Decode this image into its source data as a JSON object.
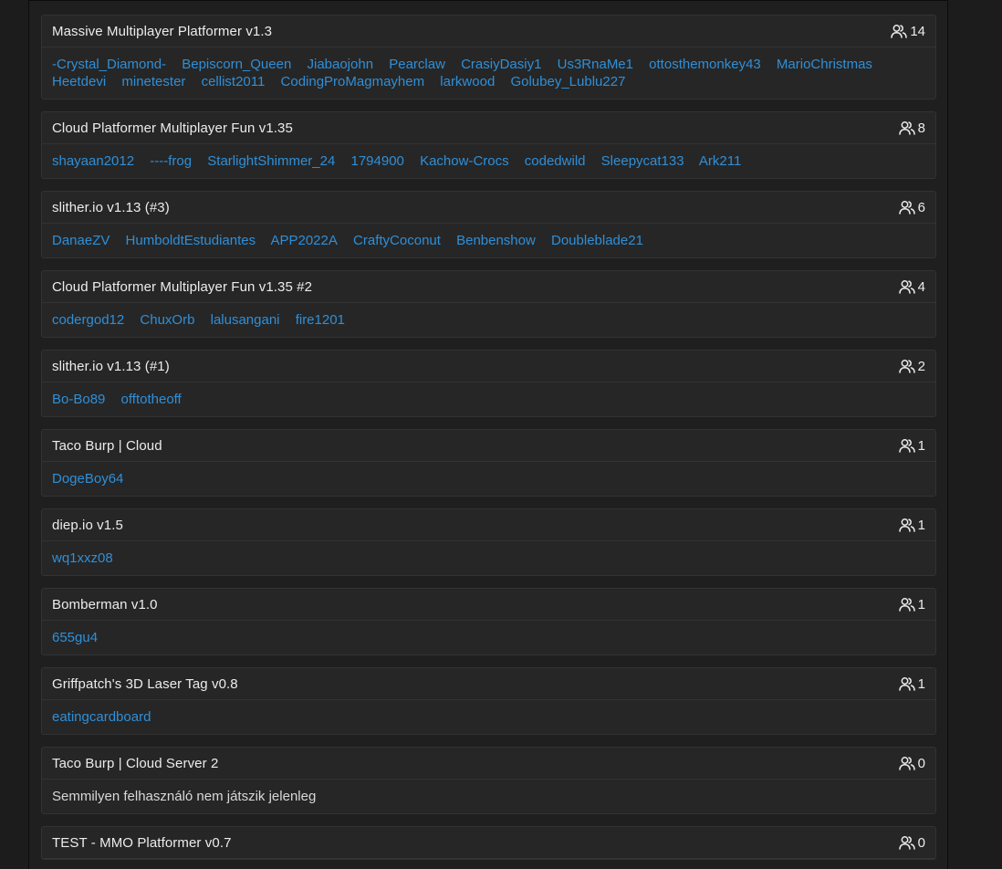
{
  "rooms": [
    {
      "title": "Massive Multiplayer Platformer v1.3",
      "count": "14",
      "users": [
        "-Crystal_Diamond-",
        "Bepiscorn_Queen",
        "Jiabaojohn",
        "Pearclaw",
        "CrasiyDasiy1",
        "Us3RnaMe1",
        "ottosthemonkey43",
        "MarioChristmas",
        "Heetdevi",
        "minetester",
        "cellist2011",
        "CodingProMagmayhem",
        "larkwood",
        "Golubey_Lublu227"
      ]
    },
    {
      "title": "Cloud Platformer Multiplayer Fun v1.35",
      "count": "8",
      "users": [
        "shayaan2012",
        "----frog",
        "StarlightShimmer_24",
        "1794900",
        "Kachow-Crocs",
        "codedwild",
        "Sleepycat133",
        "Ark211"
      ]
    },
    {
      "title": "slither.io v1.13 (#3)",
      "count": "6",
      "users": [
        "DanaeZV",
        "HumboldtEstudiantes",
        "APP2022A",
        "CraftyCoconut",
        "Benbenshow",
        "Doubleblade21"
      ]
    },
    {
      "title": "Cloud Platformer Multiplayer Fun v1.35 #2",
      "count": "4",
      "users": [
        "codergod12",
        "ChuxOrb",
        "lalusangani",
        "fire1201"
      ]
    },
    {
      "title": "slither.io v1.13 (#1)",
      "count": "2",
      "users": [
        "Bo-Bo89",
        "offtotheoff"
      ]
    },
    {
      "title": "Taco Burp | Cloud",
      "count": "1",
      "users": [
        "DogeBoy64"
      ]
    },
    {
      "title": "diep.io v1.5",
      "count": "1",
      "users": [
        "wq1xxz08"
      ]
    },
    {
      "title": "Bomberman v1.0",
      "count": "1",
      "users": [
        "655gu4"
      ]
    },
    {
      "title": "Griffpatch's 3D Laser Tag v0.8",
      "count": "1",
      "users": [
        "eatingcardboard"
      ]
    },
    {
      "title": "Taco Burp | Cloud Server 2",
      "count": "0",
      "users": [],
      "empty_text": "Semmilyen felhasználó nem játszik jelenleg"
    },
    {
      "title": "TEST - MMO Platformer v0.7",
      "count": "0",
      "users": []
    }
  ],
  "icons": {
    "count_icon": "users-icon"
  },
  "colors": {
    "link": "#2f8fd8",
    "card_bg": "#262626",
    "page_bg": "#1c1c1c"
  }
}
